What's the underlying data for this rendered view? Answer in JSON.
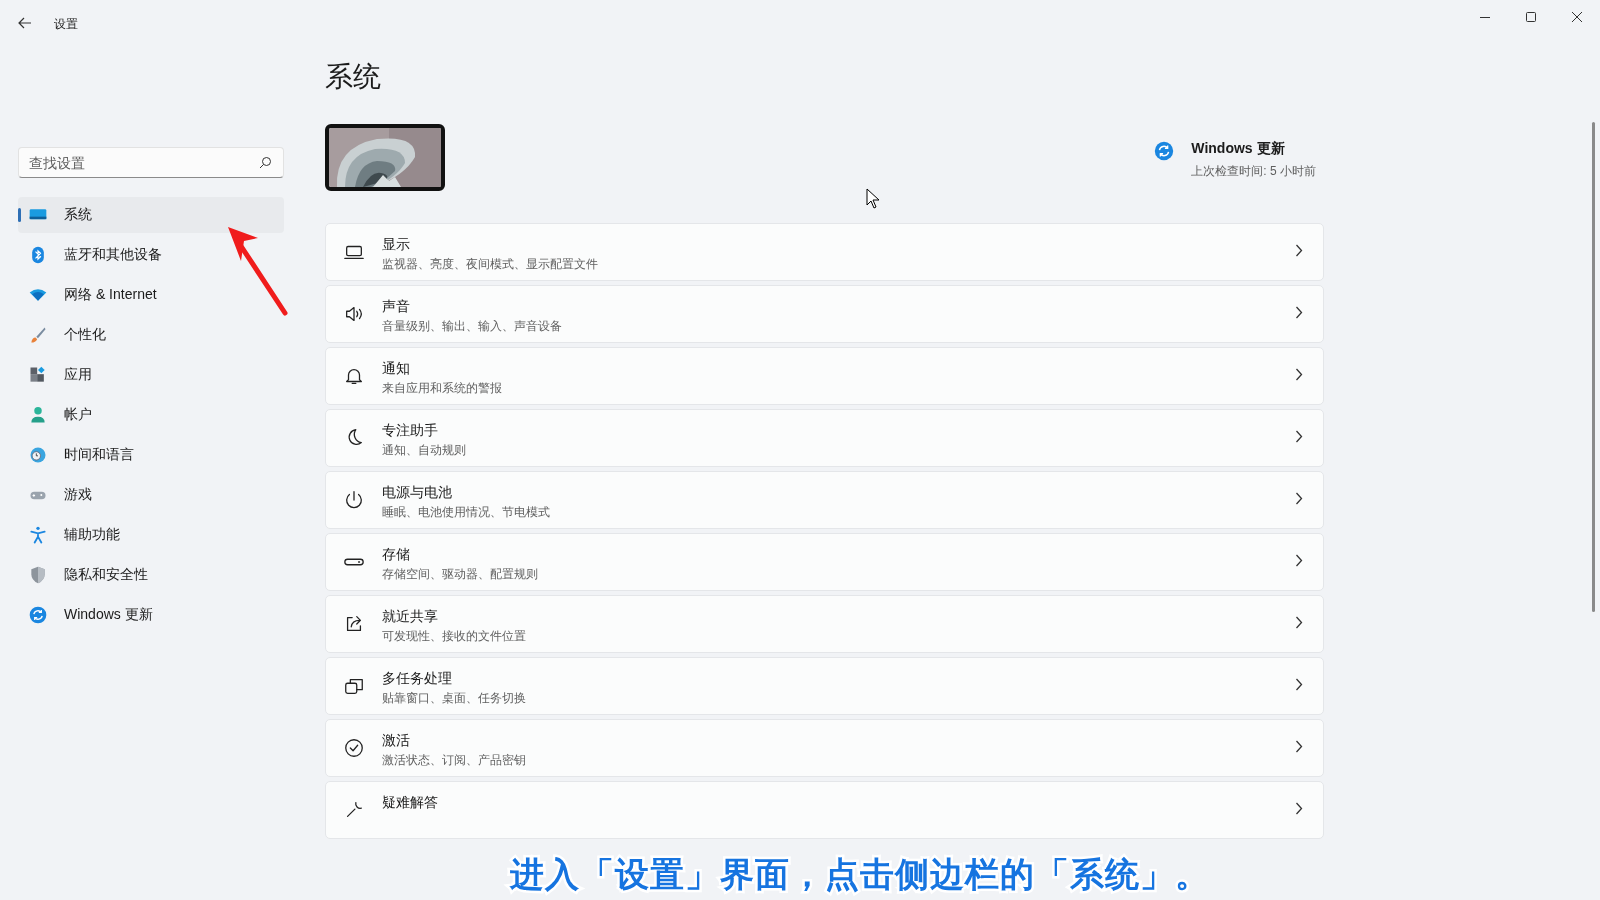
{
  "window": {
    "title": "设置"
  },
  "search": {
    "placeholder": "查找设置"
  },
  "nav": [
    {
      "label": "系统",
      "selected": true
    },
    {
      "label": "蓝牙和其他设备",
      "selected": false
    },
    {
      "label": "网络 & Internet",
      "selected": false
    },
    {
      "label": "个性化",
      "selected": false
    },
    {
      "label": "应用",
      "selected": false
    },
    {
      "label": "帐户",
      "selected": false
    },
    {
      "label": "时间和语言",
      "selected": false
    },
    {
      "label": "游戏",
      "selected": false
    },
    {
      "label": "辅助功能",
      "selected": false
    },
    {
      "label": "隐私和安全性",
      "selected": false
    },
    {
      "label": "Windows 更新",
      "selected": false
    }
  ],
  "page": {
    "title": "系统"
  },
  "update": {
    "title": "Windows 更新",
    "subtitle": "上次检查时间: 5 小时前"
  },
  "rows": [
    {
      "title": "显示",
      "subtitle": "监视器、亮度、夜间模式、显示配置文件"
    },
    {
      "title": "声音",
      "subtitle": "音量级别、输出、输入、声音设备"
    },
    {
      "title": "通知",
      "subtitle": "来自应用和系统的警报"
    },
    {
      "title": "专注助手",
      "subtitle": "通知、自动规则"
    },
    {
      "title": "电源与电池",
      "subtitle": "睡眠、电池使用情况、节电模式"
    },
    {
      "title": "存储",
      "subtitle": "存储空间、驱动器、配置规则"
    },
    {
      "title": "就近共享",
      "subtitle": "可发现性、接收的文件位置"
    },
    {
      "title": "多任务处理",
      "subtitle": "贴靠窗口、桌面、任务切换"
    },
    {
      "title": "激活",
      "subtitle": "激活状态、订阅、产品密钥"
    },
    {
      "title": "疑难解答"
    }
  ],
  "caption": "进入「设置」界面，点击侧边栏的「系统」。"
}
